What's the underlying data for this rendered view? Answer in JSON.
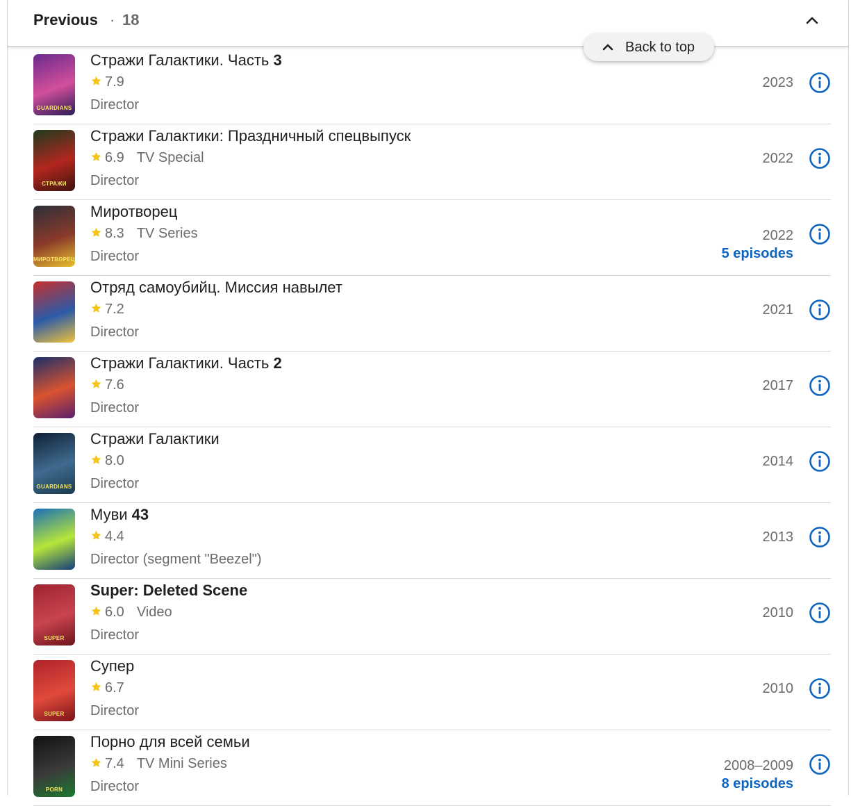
{
  "section": {
    "title": "Previous",
    "separator": "·",
    "count": "18"
  },
  "back_to_top": {
    "label": "Back to top"
  },
  "colors": {
    "accent": "#0e63be",
    "star": "#f5c518",
    "muted_text": "#6b6b6b"
  },
  "items": [
    {
      "title_plain": "Стражи Галактики. Часть ",
      "title_bold": "3",
      "rating": "7.9",
      "type": "",
      "role": "Director",
      "year": "2023",
      "episodes": "",
      "poster_colors": [
        "#6b2a8c",
        "#d24f9b",
        "#2a1c57"
      ],
      "poster_text": "GUARDIANS"
    },
    {
      "title_plain": "Стражи Галактики: Праздничный спецвыпуск",
      "title_bold": "",
      "rating": "6.9",
      "type": "TV Special",
      "role": "Director",
      "year": "2022",
      "episodes": "",
      "poster_colors": [
        "#1d3b1f",
        "#b3261e",
        "#3c1410"
      ],
      "poster_text": "СТРАЖИ"
    },
    {
      "title_plain": "Миротворец",
      "title_bold": "",
      "rating": "8.3",
      "type": "TV Series",
      "role": "Director",
      "year": "2022",
      "episodes": "5 episodes",
      "poster_colors": [
        "#2c2f39",
        "#8a3a2a",
        "#e8c02c"
      ],
      "poster_text": "МИРОТВОРЕЦ"
    },
    {
      "title_plain": "Отряд самоубийц. Миссия навылет",
      "title_bold": "",
      "rating": "7.2",
      "type": "",
      "role": "Director",
      "year": "2021",
      "episodes": "",
      "poster_colors": [
        "#c7302d",
        "#2b5aa8",
        "#f0c33c"
      ],
      "poster_text": ""
    },
    {
      "title_plain": "Стражи Галактики. Часть ",
      "title_bold": "2",
      "rating": "7.6",
      "type": "",
      "role": "Director",
      "year": "2017",
      "episodes": "",
      "poster_colors": [
        "#1b2f6b",
        "#d9532f",
        "#5a1f6e"
      ],
      "poster_text": ""
    },
    {
      "title_plain": "Стражи Галактики",
      "title_bold": "",
      "rating": "8.0",
      "type": "",
      "role": "Director",
      "year": "2014",
      "episodes": "",
      "poster_colors": [
        "#0f2035",
        "#3f6b8f",
        "#1a3a4f"
      ],
      "poster_text": "GUARDIANS"
    },
    {
      "title_plain": "Муви ",
      "title_bold": "43",
      "rating": "4.4",
      "type": "",
      "role": "Director (segment \"Beezel\")",
      "year": "2013",
      "episodes": "",
      "poster_colors": [
        "#1b6fb8",
        "#b7e53a",
        "#123d7a"
      ],
      "poster_text": ""
    },
    {
      "title_plain": "",
      "title_bold": "Super: Deleted Scene",
      "rating": "6.0",
      "type": "Video",
      "role": "Director",
      "year": "2010",
      "episodes": "",
      "poster_colors": [
        "#9d2430",
        "#c8444f",
        "#6e141c"
      ],
      "poster_text": "SUPER"
    },
    {
      "title_plain": "Супер",
      "title_bold": "",
      "rating": "6.7",
      "type": "",
      "role": "Director",
      "year": "2010",
      "episodes": "",
      "poster_colors": [
        "#b0232b",
        "#e04a3c",
        "#7a1218"
      ],
      "poster_text": "SUPER"
    },
    {
      "title_plain": "Порно для всей семьи",
      "title_bold": "",
      "rating": "7.4",
      "type": "TV Mini Series",
      "role": "Director",
      "year": "2008–2009",
      "episodes": "8 episodes",
      "poster_colors": [
        "#111111",
        "#3a3a3a",
        "#1c7a2e"
      ],
      "poster_text": "PORN"
    }
  ]
}
